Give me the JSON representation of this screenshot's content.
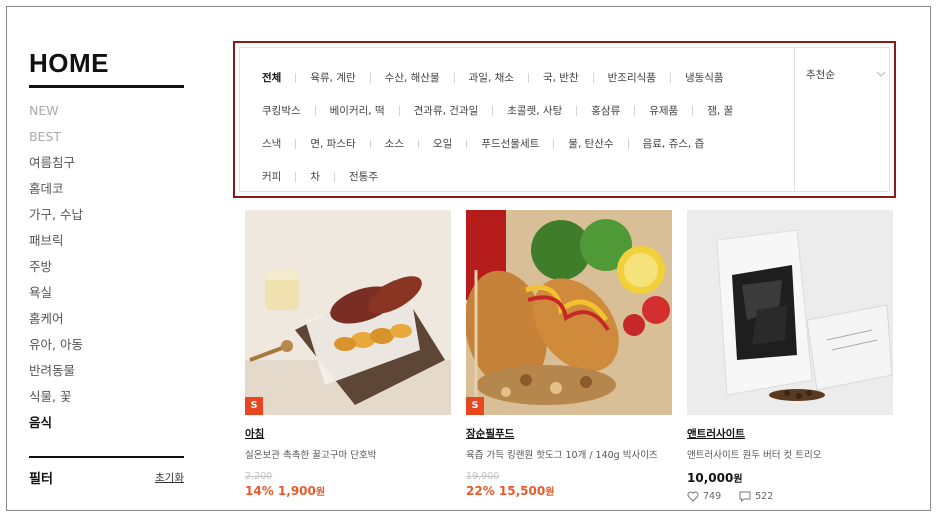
{
  "sidebar": {
    "title": "HOME",
    "categories": [
      {
        "label": "NEW"
      },
      {
        "label": "BEST"
      },
      {
        "label": "여름침구"
      },
      {
        "label": "홈데코"
      },
      {
        "label": "가구, 수납"
      },
      {
        "label": "패브릭"
      },
      {
        "label": "주방"
      },
      {
        "label": "욕실"
      },
      {
        "label": "홈케어"
      },
      {
        "label": "유아, 아동"
      },
      {
        "label": "반려동물"
      },
      {
        "label": "식물, 꽃"
      },
      {
        "label": "음식"
      }
    ],
    "active_category": "음식",
    "filter_label": "필터",
    "reset_label": "초기화"
  },
  "subcategories": {
    "rows": [
      [
        "전체",
        "육류, 계란",
        "수산, 해산물",
        "과일, 채소",
        "국, 반찬",
        "반조리식품",
        "냉동식품"
      ],
      [
        "쿠킹박스",
        "베이커리, 떡",
        "견과류, 건과일",
        "초콜렛, 사탕",
        "홍삼류",
        "유제품",
        "잼, 꿀"
      ],
      [
        "스낵",
        "면, 파스타",
        "소스",
        "오일",
        "푸드선물세트",
        "물, 탄산수",
        "음료, 쥬스, 즙"
      ],
      [
        "커피",
        "차",
        "전통주"
      ]
    ],
    "active": "전체",
    "sort_label": "추천순"
  },
  "products": [
    {
      "badge": "S",
      "brand": "아침",
      "name": "실온보관 촉촉한 꿀고구마 단호박",
      "original_price": "2,200",
      "discount": "14%",
      "price": "1,900",
      "price_unit": "원",
      "likes": "",
      "reviews": ""
    },
    {
      "badge": "S",
      "brand": "장순필푸드",
      "name": "육즙 가득 킹랜원 핫도그 10개 / 140g 빅사이즈",
      "original_price": "19,900",
      "discount": "22%",
      "price": "15,500",
      "price_unit": "원",
      "likes": "",
      "reviews": ""
    },
    {
      "badge": "",
      "brand": "앤트러사이트",
      "name": "앤트러사이트 원두 버터 컷 트리오",
      "original_price": "",
      "discount": "",
      "price": "10,000",
      "price_unit": "원",
      "likes": "749",
      "reviews": "522"
    }
  ],
  "colors": {
    "highlight_border": "#8b1a1a",
    "sale_price": "#e85a2a",
    "badge": "#e8461e",
    "text_dark": "#111111"
  }
}
